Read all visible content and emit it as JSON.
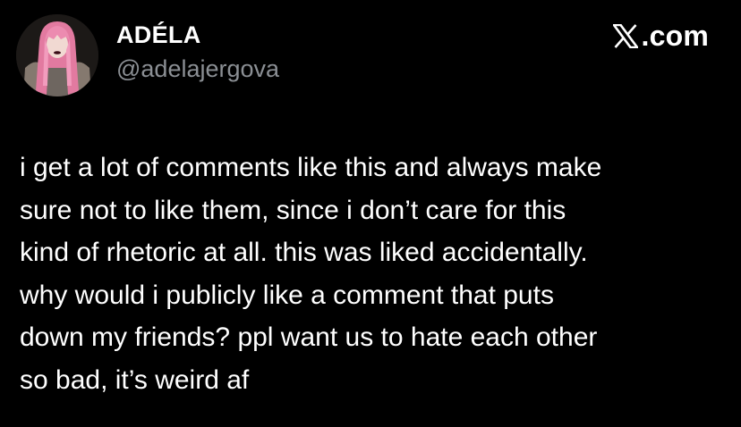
{
  "author": {
    "display_name": "ADÉLA",
    "handle": "@adelajergova",
    "avatar_icon": "profile-avatar"
  },
  "brand": {
    "icon": "x-logo-icon",
    "text": ".com"
  },
  "tweet": {
    "lines": [
      "i get a lot of comments like this and always make",
      "sure not to like them, since i don’t care for this",
      "kind of rhetoric at all. this was liked accidentally.",
      "why would i publicly like a comment that puts",
      "down my friends? ppl want us to hate each other",
      "so bad, it’s weird af"
    ]
  },
  "colors": {
    "background": "#000000",
    "text_primary": "#ffffff",
    "text_secondary": "#8b8f94"
  }
}
